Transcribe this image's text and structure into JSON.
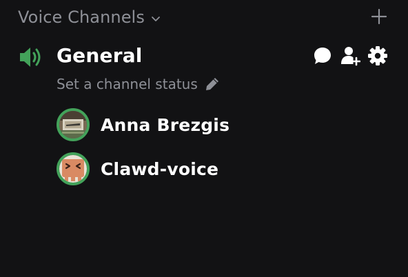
{
  "category": {
    "title": "Voice Channels",
    "chevron_icon": "chevron-down-icon",
    "add_icon": "plus-icon"
  },
  "channel": {
    "name": "General",
    "type_icon": "speaker-icon",
    "status_placeholder": "Set a channel status",
    "actions": [
      "chat-bubble-icon",
      "invite-user-icon",
      "gear-icon"
    ]
  },
  "voice_users": [
    {
      "name": "Anna Brezgis",
      "avatar_icon": "photo-avatar"
    },
    {
      "name": "Clawd-voice",
      "avatar_icon": "clawd-avatar"
    }
  ],
  "colors": {
    "background": "#121214",
    "muted_text": "#8e9097",
    "speaking_ring": "#43a25a",
    "speaker_green": "#43a25a",
    "text_primary": "#ffffff"
  }
}
